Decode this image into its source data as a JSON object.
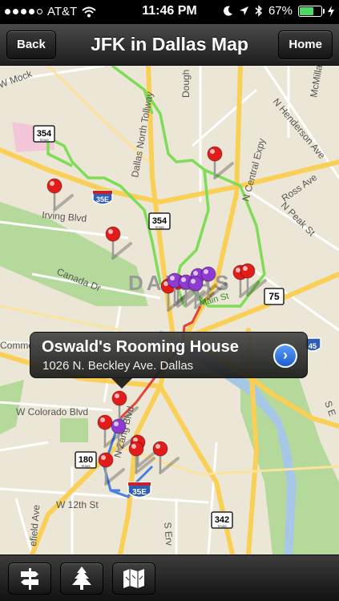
{
  "status": {
    "carrier": "AT&T",
    "time": "11:46 PM",
    "battery_text": "67%",
    "battery_level": 0.67,
    "signal_bars_filled": 4,
    "signal_bars_total": 5
  },
  "nav": {
    "back_label": "Back",
    "title": "JFK in Dallas Map",
    "home_label": "Home"
  },
  "map": {
    "street_labels": {
      "w_mock": "W Mock",
      "dallas_north_tollway": "Dallas North Tollway",
      "dougherty": "Dough",
      "n_central_expy": "N Central Expy",
      "n_henderson": "N Henderson Ave",
      "mcmillan": "McMillan",
      "ross_ave": "Ross Ave",
      "n_peak": "N Peak St",
      "irving_blvd": "Irving Blvd",
      "canada_dr": "Canada Dr",
      "dallas": "DALLAS",
      "main_st": "Main St",
      "commerce": "Comme",
      "w_colorado": "W Colorado Blvd",
      "n_zang": "N Zang Blvd",
      "w_12th": "W 12th St",
      "s_e": "S E",
      "s_ervay": "S Erv",
      "edefield": "efield Ave"
    },
    "shields": {
      "r354a": "354",
      "r354b": "354",
      "i35e_n": "35E",
      "i35e_s": "35E",
      "r180": "180",
      "r75": "75",
      "r342": "342",
      "i45": "45"
    },
    "shield_state_text": "TEXAS"
  },
  "callout": {
    "title": "Oswald's Rooming House",
    "subtitle": "1026 N. Beckley Ave. Dallas",
    "disclosure_glyph": "›"
  },
  "toolbar": {
    "items": [
      {
        "icon": "signpost-icon"
      },
      {
        "icon": "tree-icon"
      },
      {
        "icon": "map-icon"
      }
    ]
  },
  "colors": {
    "route_green": "#7fdc57",
    "route_red": "#e3433a",
    "route_blue": "#4a7fe0",
    "pin_red": "#e21b1b",
    "pin_purple": "#8f3ad0",
    "park_green": "#b4d99a",
    "water_blue": "#a7c7e7",
    "highway_yellow": "#f9cf55"
  }
}
